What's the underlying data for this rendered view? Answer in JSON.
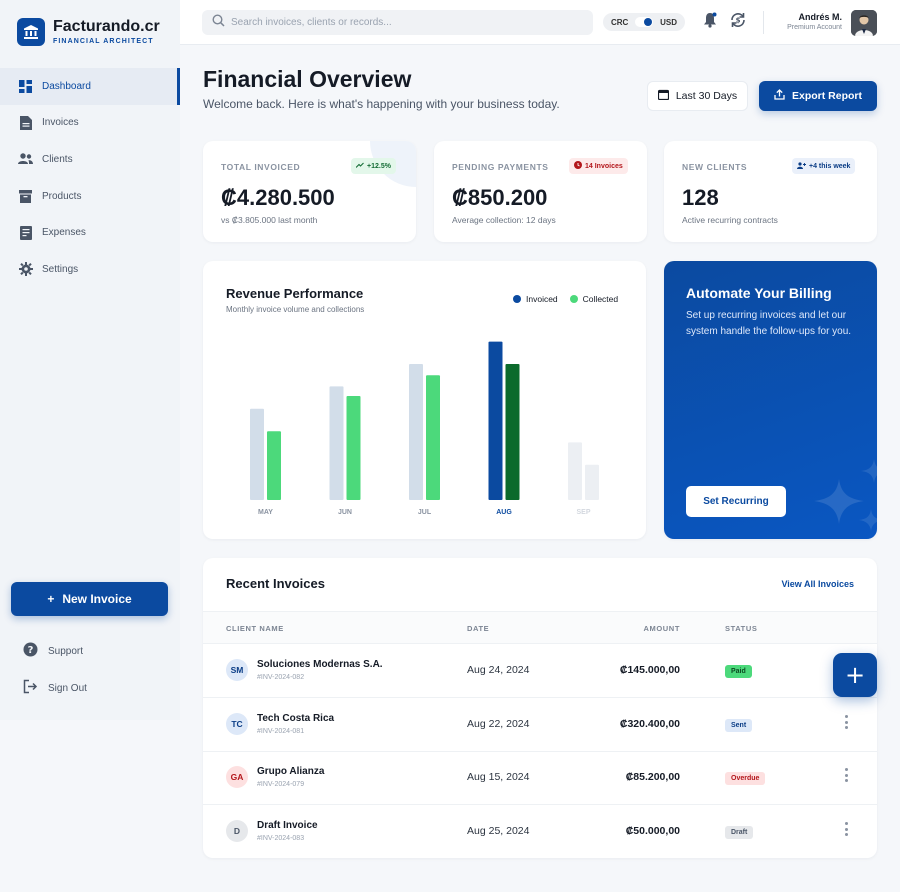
{
  "brand": {
    "name": "Facturando.cr",
    "tagline": "FINANCIAL ARCHITECT"
  },
  "sidebar": {
    "items": [
      {
        "label": "Dashboard",
        "icon": "grid-icon",
        "active": true
      },
      {
        "label": "Invoices",
        "icon": "document-icon"
      },
      {
        "label": "Clients",
        "icon": "users-icon"
      },
      {
        "label": "Products",
        "icon": "box-icon"
      },
      {
        "label": "Expenses",
        "icon": "receipt-icon"
      },
      {
        "label": "Settings",
        "icon": "gear-icon"
      }
    ],
    "new_invoice": "New Invoice",
    "support": "Support",
    "sign_out": "Sign Out"
  },
  "topbar": {
    "search_placeholder": "Search invoices, clients or records...",
    "currency_left": "CRC",
    "currency_right": "USD",
    "user_name": "Andrés M.",
    "user_role": "Premium Account"
  },
  "header": {
    "title": "Financial Overview",
    "subtitle": "Welcome back. Here is what's happening with your business today.",
    "date_range": "Last 30 Days",
    "export": "Export Report"
  },
  "stats": [
    {
      "label": "TOTAL INVOICED",
      "badge": "+12.5%",
      "value": "₡4.280.500",
      "note": "vs ₡3.805.000 last month"
    },
    {
      "label": "PENDING PAYMENTS",
      "badge": "14 Invoices",
      "value": "₡850.200",
      "note": "Average collection: 12 days"
    },
    {
      "label": "NEW CLIENTS",
      "badge": "+4 this week",
      "value": "128",
      "note": "Active recurring contracts"
    }
  ],
  "chart": {
    "title": "Revenue Performance",
    "subtitle": "Monthly invoice volume and collections",
    "legend_invoiced": "Invoiced",
    "legend_collected": "Collected"
  },
  "chart_data": {
    "type": "bar",
    "categories": [
      "MAY",
      "JUN",
      "JUL",
      "AUG",
      "SEP"
    ],
    "highlight": "AUG",
    "ylim": [
      0,
      100
    ],
    "series": [
      {
        "name": "Invoiced",
        "values": [
          57,
          71,
          85,
          99,
          36
        ]
      },
      {
        "name": "Collected",
        "values": [
          43,
          65,
          78,
          85,
          22
        ]
      }
    ],
    "colors": {
      "invoiced": "#d2dde9",
      "collected": "#4cd97b",
      "invoiced_highlight": "#0b4aa0",
      "collected_highlight": "#0b6a2c",
      "invoiced_faded": "#eceff3",
      "collected_faded": "#eceff3"
    }
  },
  "automate": {
    "title": "Automate Your Billing",
    "text": "Set up recurring invoices and let our system handle the follow-ups for you.",
    "button": "Set Recurring"
  },
  "invoices": {
    "title": "Recent Invoices",
    "view_all": "View All Invoices",
    "columns": {
      "client": "CLIENT NAME",
      "date": "DATE",
      "amount": "AMOUNT",
      "status": "STATUS"
    },
    "rows": [
      {
        "initials": "SM",
        "name": "Soluciones Modernas S.A.",
        "id": "#INV-2024-082",
        "date": "Aug 24, 2024",
        "amount": "₡145.000,00",
        "status": "Paid"
      },
      {
        "initials": "TC",
        "name": "Tech Costa Rica",
        "id": "#INV-2024-081",
        "date": "Aug 22, 2024",
        "amount": "₡320.400,00",
        "status": "Sent"
      },
      {
        "initials": "GA",
        "name": "Grupo Alianza",
        "id": "#INV-2024-079",
        "date": "Aug 15, 2024",
        "amount": "₡85.200,00",
        "status": "Overdue"
      },
      {
        "initials": "D",
        "name": "Draft Invoice",
        "id": "#INV-2024-083",
        "date": "Aug 25, 2024",
        "amount": "₡50.000,00",
        "status": "Draft"
      }
    ]
  },
  "fab_label": "+"
}
